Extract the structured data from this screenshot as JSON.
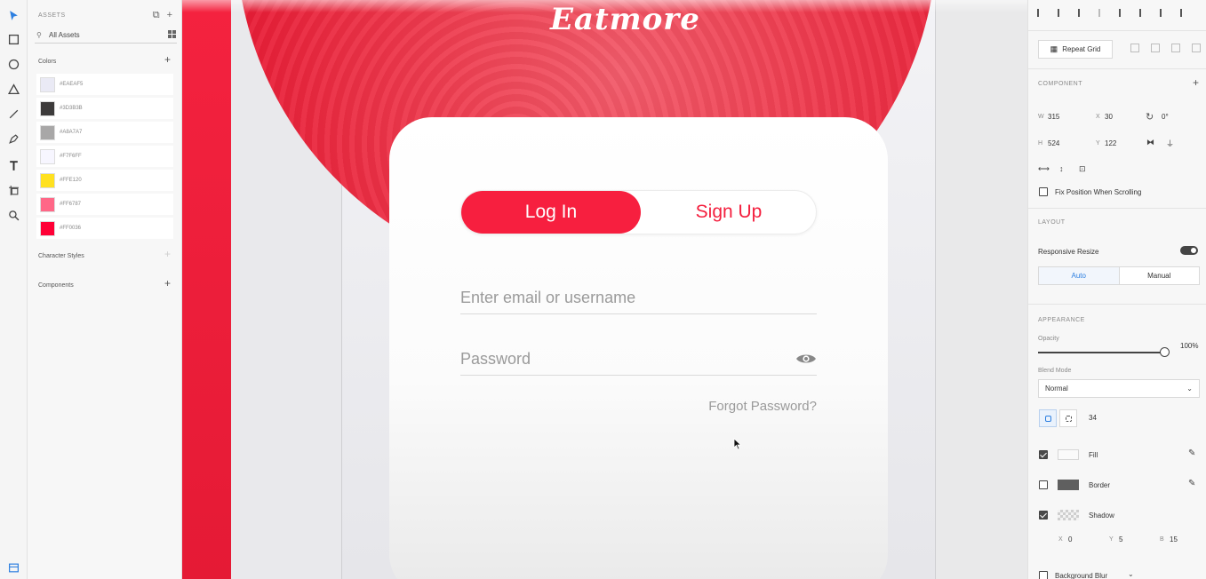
{
  "tools": [
    {
      "name": "select-icon"
    },
    {
      "name": "rectangle-icon"
    },
    {
      "name": "ellipse-icon"
    },
    {
      "name": "polygon-icon"
    },
    {
      "name": "line-icon"
    },
    {
      "name": "pen-icon"
    },
    {
      "name": "text-icon"
    },
    {
      "name": "artboard-icon"
    },
    {
      "name": "zoom-icon"
    }
  ],
  "assets": {
    "header": "ASSETS",
    "filter": "All Assets",
    "colors_label": "Colors",
    "colors": [
      {
        "hex": "#EAEAF5",
        "color": "#EAEAF5"
      },
      {
        "hex": "#3D3B3B",
        "color": "#3D3B3B"
      },
      {
        "hex": "#A8A7A7",
        "color": "#A8A7A7"
      },
      {
        "hex": "#F7F6FF",
        "color": "#F7F6FF"
      },
      {
        "hex": "#FFE120",
        "color": "#FFE120"
      },
      {
        "hex": "#FF6787",
        "color": "#FF6787"
      },
      {
        "hex": "#FF0036",
        "color": "#FF0036"
      }
    ],
    "character_styles_label": "Character Styles",
    "components_label": "Components"
  },
  "canvas": {
    "logo": "Eatmore",
    "login_tab": "Log In",
    "signup_tab": "Sign Up",
    "email_placeholder": "Enter email or username",
    "password_placeholder": "Password",
    "forgot": "Forgot Password?",
    "accent": "#F71F3F"
  },
  "props": {
    "repeat_grid": "Repeat Grid",
    "component_label": "COMPONENT",
    "w_label": "W",
    "w": "315",
    "x_label": "X",
    "x": "30",
    "h_label": "H",
    "h": "524",
    "y_label": "Y",
    "y": "122",
    "rotation": "0°",
    "fix_position": "Fix Position When Scrolling",
    "layout_label": "LAYOUT",
    "responsive_resize": "Responsive Resize",
    "auto": "Auto",
    "manual": "Manual",
    "appearance_label": "APPEARANCE",
    "opacity_label": "Opacity",
    "opacity": "100%",
    "blend_label": "Blend Mode",
    "blend": "Normal",
    "radius": "34",
    "fill": "Fill",
    "border": "Border",
    "shadow": "Shadow",
    "shadow_x_label": "X",
    "shadow_x": "0",
    "shadow_y_label": "Y",
    "shadow_y": "5",
    "shadow_b_label": "B",
    "shadow_b": "15",
    "background_blur": "Background Blur"
  }
}
